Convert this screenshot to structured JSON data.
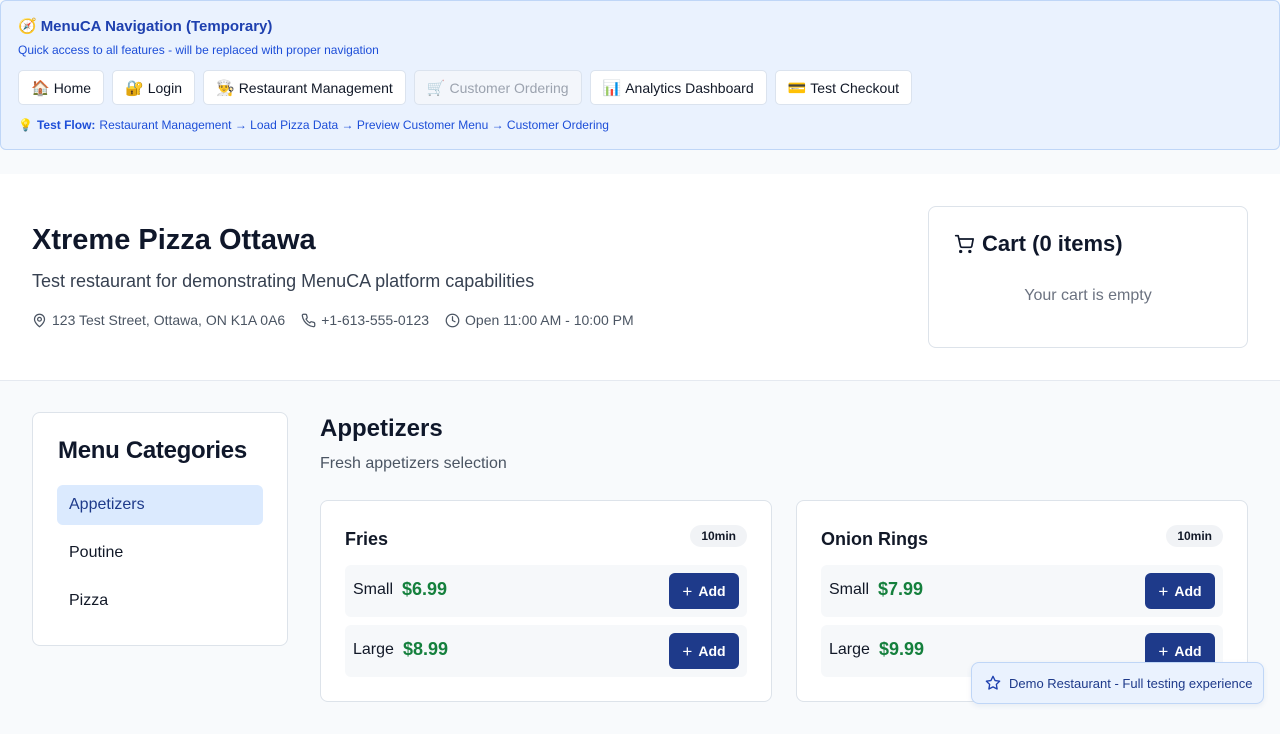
{
  "tempnav": {
    "icon": "compass-emoji",
    "title": "MenuCA Navigation (Temporary)",
    "subtitle": "Quick access to all features - will be replaced with proper navigation",
    "buttons": [
      {
        "emoji": "🏠",
        "label": "Home"
      },
      {
        "emoji": "🔐",
        "label": "Login"
      },
      {
        "emoji": "👨‍🍳",
        "label": "Restaurant Management"
      },
      {
        "emoji": "🛒",
        "label": "Customer Ordering"
      },
      {
        "emoji": "📊",
        "label": "Analytics Dashboard"
      },
      {
        "emoji": "💳",
        "label": "Test Checkout"
      }
    ],
    "testflow_label": "Test Flow:",
    "testflow_steps": "Restaurant Management → Load Pizza Data → Preview Customer Menu → Customer Ordering"
  },
  "restaurant": {
    "name": "Xtreme Pizza Ottawa",
    "description": "Test restaurant for demonstrating MenuCA platform capabilities",
    "address": "123 Test Street, Ottawa, ON K1A 0A6",
    "phone": "+1-613-555-0123",
    "hours": "Open 11:00 AM - 10:00 PM"
  },
  "cart": {
    "title": "Cart (0 items)",
    "empty_text": "Your cart is empty"
  },
  "categories": {
    "title": "Menu Categories",
    "items": [
      "Appetizers",
      "Poutine",
      "Pizza"
    ],
    "active": "Appetizers"
  },
  "section": {
    "title": "Appetizers",
    "description": "Fresh appetizers selection",
    "items": [
      {
        "name": "Fries",
        "time": "10min",
        "sizes": [
          {
            "size": "Small",
            "price": "$6.99",
            "button": "Add"
          },
          {
            "size": "Large",
            "price": "$8.99",
            "button": "Add"
          }
        ]
      },
      {
        "name": "Onion Rings",
        "time": "10min",
        "sizes": [
          {
            "size": "Small",
            "price": "$7.99",
            "button": "Add"
          },
          {
            "size": "Large",
            "price": "$9.99",
            "button": "Add"
          }
        ]
      }
    ]
  },
  "demo_badge": {
    "text": "Demo Restaurant - Full testing experience"
  },
  "colors": {
    "primary": "#1e3a8a",
    "price": "#15803d",
    "nav_bg": "#eaf2fe",
    "active_category": "#dbeafe"
  }
}
